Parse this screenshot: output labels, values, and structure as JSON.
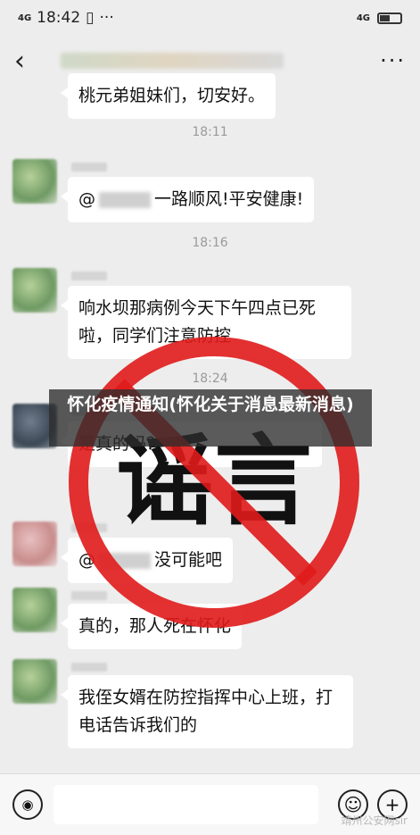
{
  "status_bar": {
    "time": "18:42",
    "network_left": "4G",
    "network_right": "4G",
    "dots": "···"
  },
  "nav": {
    "back": "‹",
    "more": "···"
  },
  "messages": [
    {
      "text": "桃元弟姐妹们，切安好。"
    },
    {
      "time": "18:11"
    },
    {
      "prefix": "@",
      "text": "一路顺风!平安健康!"
    },
    {
      "time": "18:16"
    },
    {
      "text": "响水坝那病例今天下午四点已死啦，同学们注意防控"
    },
    {
      "time": "18:24"
    },
    {
      "text": "是真的吗？"
    },
    {
      "prefix": "@",
      "text": "没可能吧"
    },
    {
      "text": "真的，那人死在怀化"
    },
    {
      "text": "我侄女婿在防控指挥中心上班，打电话告诉我们的"
    }
  ],
  "stamp": {
    "text": "谣言"
  },
  "overlay_title": "怀化疫情通知(怀化关于消息最新消息)",
  "watermark": "靖州公安网sir"
}
